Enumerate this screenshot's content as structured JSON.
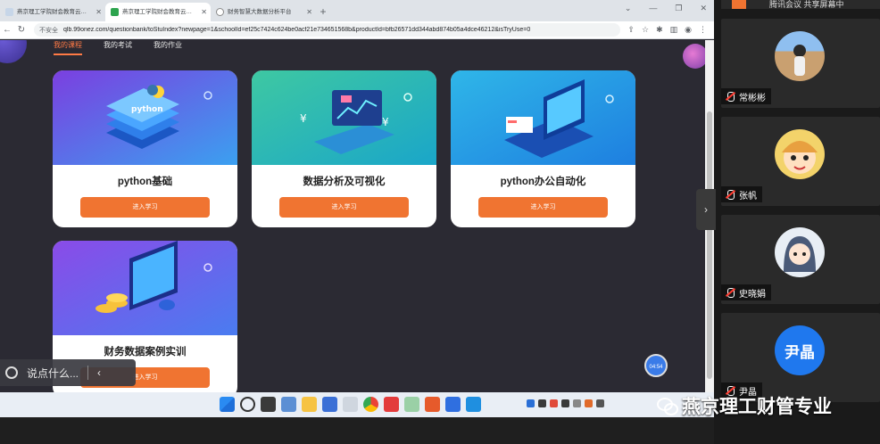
{
  "browser": {
    "tabs": [
      {
        "label": "燕京理工学院财会教育云平台",
        "favicon": "doc-icon",
        "active": false
      },
      {
        "label": "燕京理工学院财会教育云平台",
        "favicon": "green-icon",
        "active": true
      },
      {
        "label": "财务智慧大数据分析平台",
        "favicon": "globe-icon",
        "active": false
      }
    ],
    "new_tab": "+",
    "address": {
      "security_label": "不安全",
      "url": "qlb.99onez.com/questionbank/toStuIndex?newpage=1&schoolId=ef25c7424c624be0acf21e734651568b&productId=bfb26571dd344abd874b05a4dce46212&isTryUse=0"
    }
  },
  "subnav": {
    "items": [
      "我的课程",
      "我的考试",
      "我的作业"
    ],
    "active": "我的课程"
  },
  "courses": [
    {
      "title": "python基础",
      "button": "进入学习",
      "art_label": "python"
    },
    {
      "title": "数据分析及可视化",
      "button": "进入学习"
    },
    {
      "title": "python办公自动化",
      "button": "进入学习"
    },
    {
      "title": "财务数据案例实训",
      "button": "进入学习"
    }
  ],
  "chat_input": {
    "placeholder": "说点什么...",
    "collapse": "‹"
  },
  "time_badge": "04:54",
  "sidebar": {
    "participants": [
      {
        "name": "常彬彬"
      },
      {
        "name": "张帆"
      },
      {
        "name": "史晓娟"
      },
      {
        "name": "尹晶",
        "avatar_text": "尹晶"
      }
    ],
    "top_strip_text": "腾讯会议 共享屏幕中"
  },
  "watermark": "燕京理工财管专业",
  "colors": {
    "accent": "#f07431",
    "active_tab": "#ff7a45",
    "page_bg": "#2b2a33"
  }
}
